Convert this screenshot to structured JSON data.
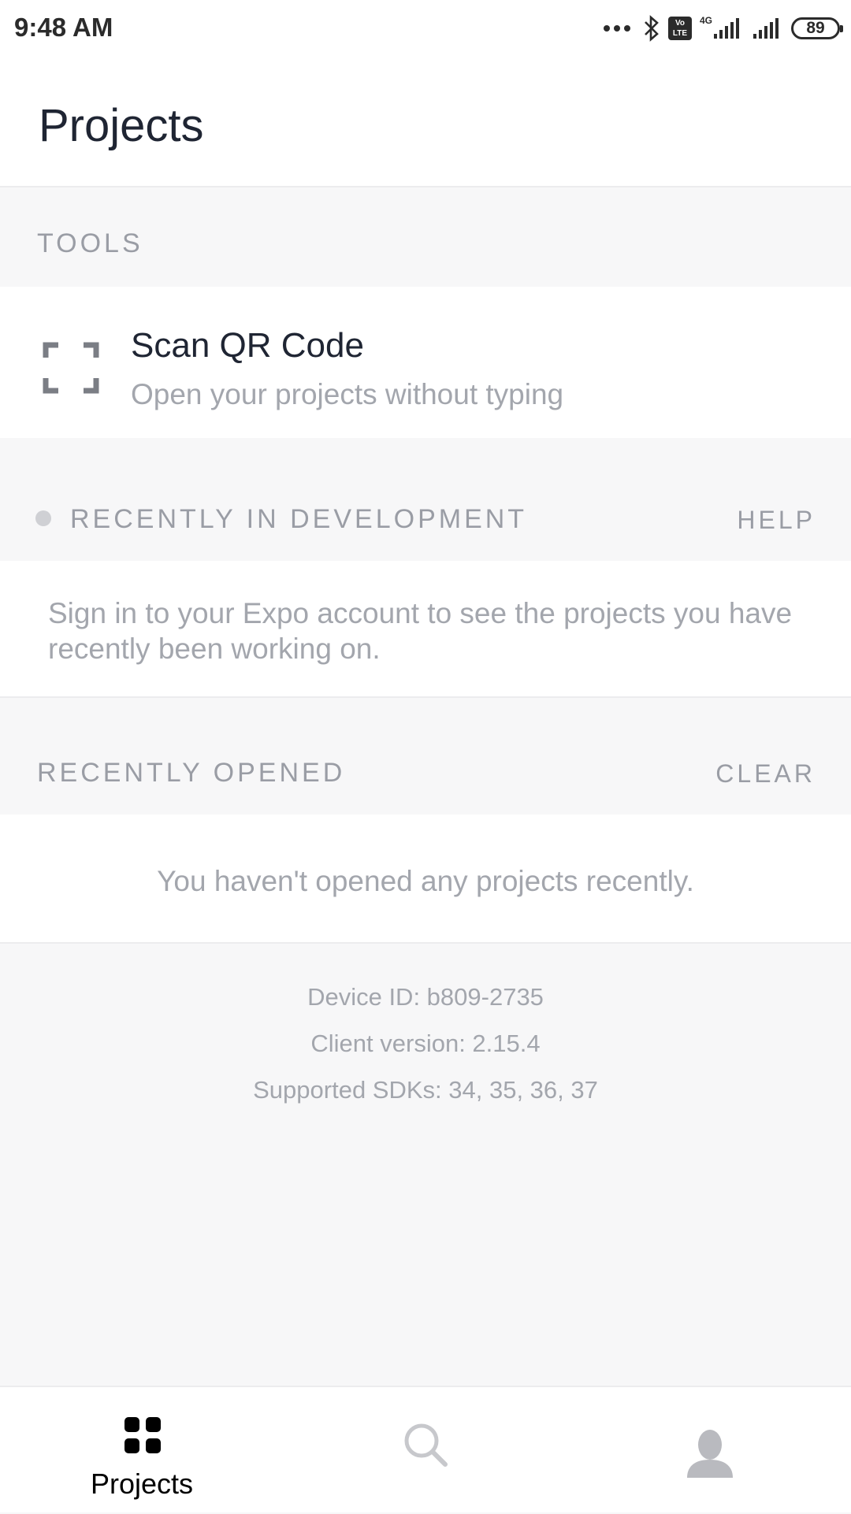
{
  "status_bar": {
    "time": "9:48 AM",
    "volte_label": "Vo LTE",
    "network": "4G",
    "battery": "89",
    "icons": [
      "dots-icon",
      "bluetooth-icon",
      "volte-icon",
      "signal-icon",
      "signal-icon",
      "battery-icon"
    ]
  },
  "header": {
    "title": "Projects"
  },
  "tools": {
    "section_title": "TOOLS",
    "scan_title": "Scan QR Code",
    "scan_subtitle": "Open your projects without typing",
    "icon": "qr-scan-icon"
  },
  "development": {
    "section_title": "RECENTLY IN DEVELOPMENT",
    "action": "HELP",
    "message": "Sign in to your Expo account to see the projects you have recently been working on."
  },
  "recent": {
    "section_title": "RECENTLY OPENED",
    "action": "CLEAR",
    "empty_message": "You haven't opened any projects recently."
  },
  "device": {
    "device_id": "Device ID: b809-2735",
    "client_version": "Client version: 2.15.4",
    "supported_sdks": "Supported SDKs: 34, 35, 36, 37"
  },
  "tabbar": {
    "projects_label": "Projects",
    "active_color": "#000000",
    "inactive_color": "#c7c8cc",
    "icons": [
      "grid-icon",
      "search-icon",
      "profile-icon"
    ]
  },
  "colors": {
    "title": "#1f2533",
    "muted": "#a3a6ad",
    "section_bg": "#f7f7f8"
  }
}
